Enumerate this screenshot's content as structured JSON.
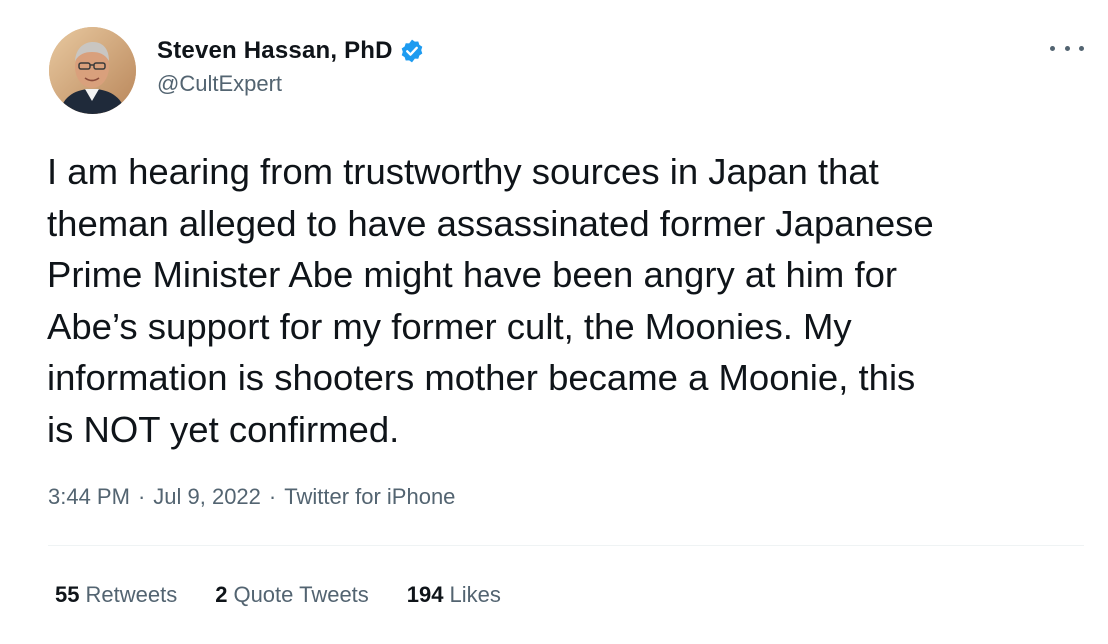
{
  "author": {
    "display_name": "Steven Hassan, PhD",
    "handle": "@CultExpert",
    "verified": true,
    "avatar_icon": "profile-photo"
  },
  "more_icon": "ellipsis-icon",
  "tweet": {
    "text": "I am hearing from trustworthy sources in Japan that\ntheman alleged to have assassinated former Japanese\nPrime Minister Abe might have been angry at him for\nAbe’s support for my former cult, the Moonies. My\ninformation is shooters mother became a Moonie, this\nis NOT yet confirmed."
  },
  "meta": {
    "time": "3:44 PM",
    "date": "Jul 9, 2022",
    "separator": "·",
    "source": "Twitter for iPhone"
  },
  "stats": [
    {
      "count": "55",
      "label": "Retweets"
    },
    {
      "count": "2",
      "label": "Quote Tweets"
    },
    {
      "count": "194",
      "label": "Likes"
    }
  ],
  "colors": {
    "text": "#0f1419",
    "secondary": "#536471",
    "verified_blue": "#1d9bf0",
    "divider": "#eff3f4"
  }
}
